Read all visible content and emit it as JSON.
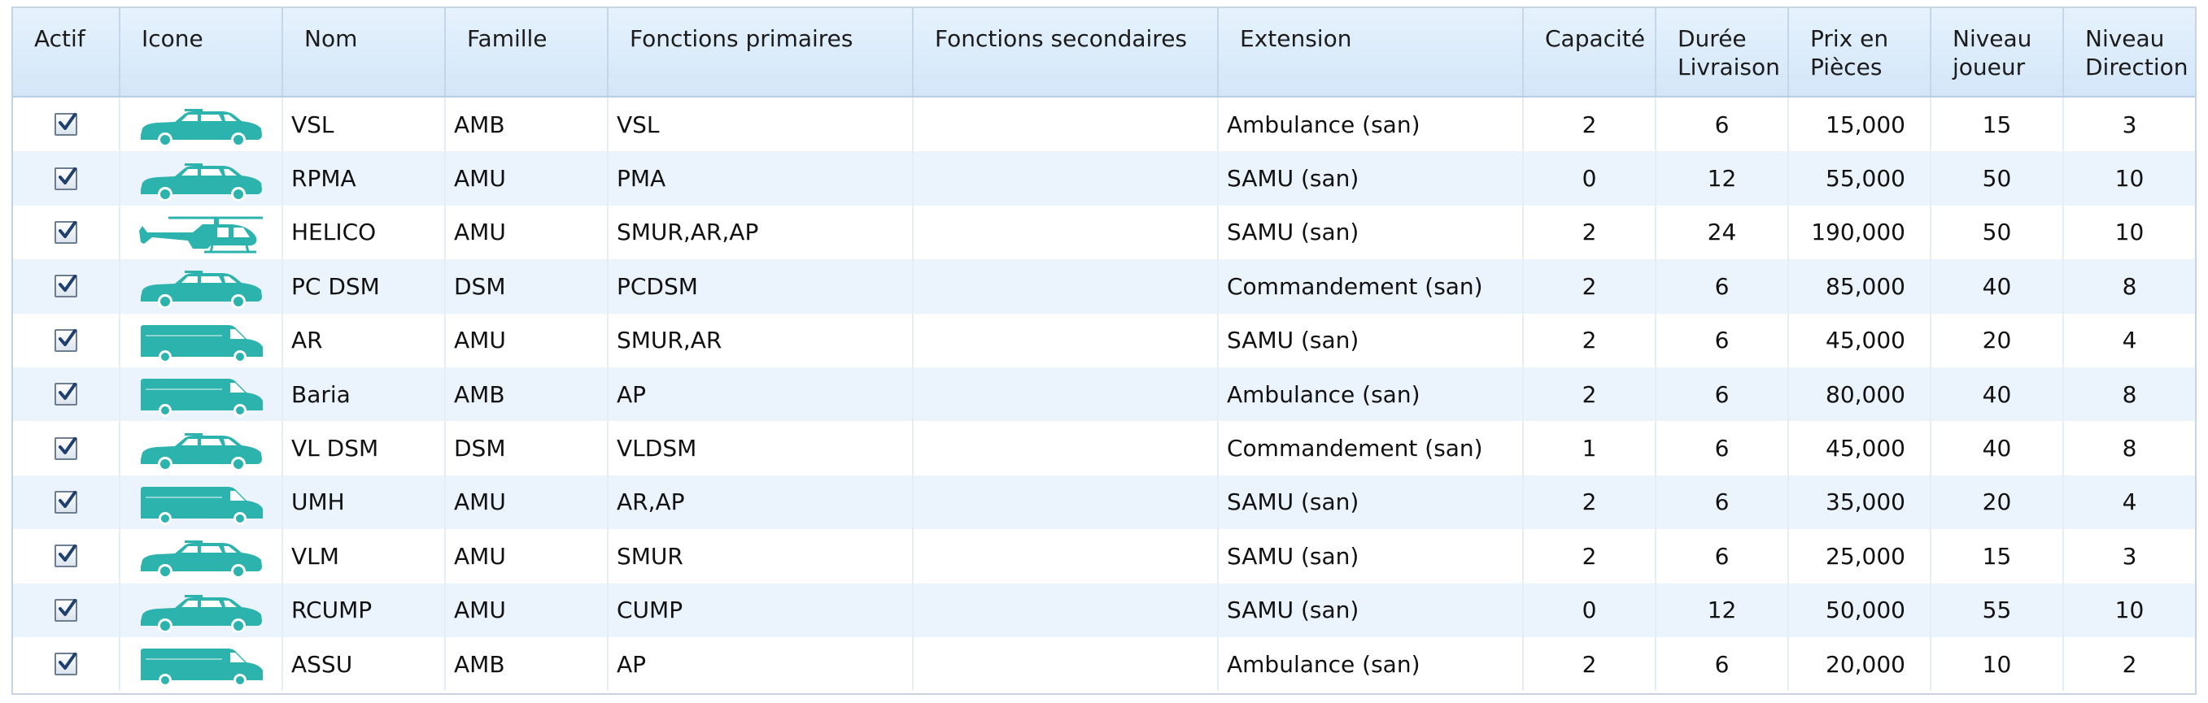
{
  "columns": {
    "actif": "Actif",
    "icone": "Icone",
    "nom": "Nom",
    "famille": "Famille",
    "fonctions_primaires": "Fonctions primaires",
    "fonctions_secondaires": "Fonctions secondaires",
    "extension": "Extension",
    "capacite": "Capacité",
    "duree_l1": "Durée",
    "duree_l2": "Livraison",
    "prix_l1": "Prix en",
    "prix_l2": "Pièces",
    "niv_joueur_l1": "Niveau",
    "niv_joueur_l2": "joueur",
    "niv_dir_l1": "Niveau",
    "niv_dir_l2": "Direction"
  },
  "rows": [
    {
      "actif": true,
      "icon": "car-icon",
      "nom": "VSL",
      "famille": "AMB",
      "fp": "VSL",
      "fs": "",
      "ext": "Ambulance (san)",
      "cap": "2",
      "duree": "6",
      "prix": "15,000",
      "nj": "15",
      "nd": "3"
    },
    {
      "actif": true,
      "icon": "car-icon",
      "nom": "RPMA",
      "famille": "AMU",
      "fp": "PMA",
      "fs": "",
      "ext": "SAMU (san)",
      "cap": "0",
      "duree": "12",
      "prix": "55,000",
      "nj": "50",
      "nd": "10"
    },
    {
      "actif": true,
      "icon": "helicopter-icon",
      "nom": "HELICO",
      "famille": "AMU",
      "fp": "SMUR,AR,AP",
      "fs": "",
      "ext": "SAMU (san)",
      "cap": "2",
      "duree": "24",
      "prix": "190,000",
      "nj": "50",
      "nd": "10"
    },
    {
      "actif": true,
      "icon": "car-icon",
      "nom": "PC DSM",
      "famille": "DSM",
      "fp": "PCDSM",
      "fs": "",
      "ext": "Commandement (san)",
      "cap": "2",
      "duree": "6",
      "prix": "85,000",
      "nj": "40",
      "nd": "8"
    },
    {
      "actif": true,
      "icon": "ambulance-icon",
      "nom": "AR",
      "famille": "AMU",
      "fp": "SMUR,AR",
      "fs": "",
      "ext": "SAMU (san)",
      "cap": "2",
      "duree": "6",
      "prix": "45,000",
      "nj": "20",
      "nd": "4"
    },
    {
      "actif": true,
      "icon": "ambulance-icon",
      "nom": "Baria",
      "famille": "AMB",
      "fp": "AP",
      "fs": "",
      "ext": "Ambulance (san)",
      "cap": "2",
      "duree": "6",
      "prix": "80,000",
      "nj": "40",
      "nd": "8"
    },
    {
      "actif": true,
      "icon": "car-icon",
      "nom": "VL DSM",
      "famille": "DSM",
      "fp": "VLDSM",
      "fs": "",
      "ext": "Commandement (san)",
      "cap": "1",
      "duree": "6",
      "prix": "45,000",
      "nj": "40",
      "nd": "8"
    },
    {
      "actif": true,
      "icon": "ambulance-icon",
      "nom": "UMH",
      "famille": "AMU",
      "fp": "AR,AP",
      "fs": "",
      "ext": "SAMU (san)",
      "cap": "2",
      "duree": "6",
      "prix": "35,000",
      "nj": "20",
      "nd": "4"
    },
    {
      "actif": true,
      "icon": "car-icon",
      "nom": "VLM",
      "famille": "AMU",
      "fp": "SMUR",
      "fs": "",
      "ext": "SAMU (san)",
      "cap": "2",
      "duree": "6",
      "prix": "25,000",
      "nj": "15",
      "nd": "3"
    },
    {
      "actif": true,
      "icon": "car-icon",
      "nom": "RCUMP",
      "famille": "AMU",
      "fp": "CUMP",
      "fs": "",
      "ext": "SAMU (san)",
      "cap": "0",
      "duree": "12",
      "prix": "50,000",
      "nj": "55",
      "nd": "10"
    },
    {
      "actif": true,
      "icon": "ambulance-icon",
      "nom": "ASSU",
      "famille": "AMB",
      "fp": "AP",
      "fs": "",
      "ext": "Ambulance (san)",
      "cap": "2",
      "duree": "6",
      "prix": "20,000",
      "nj": "10",
      "nd": "2"
    }
  ],
  "colors": {
    "vehicle": "#2db3ad",
    "header_bg": "#dcecfb",
    "alt_row_bg": "#ebf3fd",
    "check": "#1f3f6e"
  }
}
